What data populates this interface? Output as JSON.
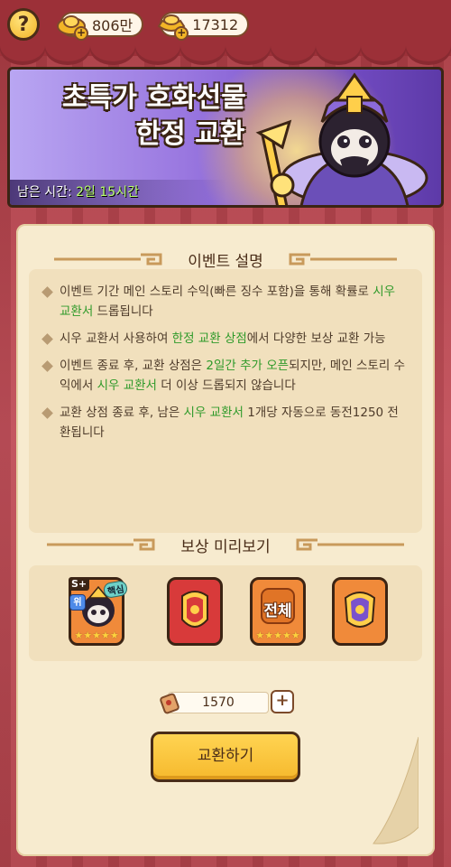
{
  "topbar": {
    "help_label": "?",
    "currencies": [
      {
        "icon": "gold-ingot-icon",
        "value": "806만"
      },
      {
        "icon": "silver-ingot-icon",
        "value": "17312"
      }
    ]
  },
  "banner": {
    "title_line1": "초특가 호화선물",
    "title_line2": "한정 교환",
    "time_label": "남은 시간: ",
    "time_value": "2일 15시간"
  },
  "description": {
    "title": "이벤트 설명",
    "items": [
      {
        "parts": [
          "이벤트 기간 메인 스토리 수익(빠른 징수 포함)을 통해 확률로 ",
          "시우 교환서",
          " 드롭됩니다"
        ]
      },
      {
        "parts": [
          "시우 교환서 사용하여 ",
          "한정 교환 상점",
          "에서 다양한 보상 교환 가능"
        ]
      },
      {
        "parts": [
          "이벤트 종료 후, 교환 상점은 ",
          "2일간 추가 오픈",
          "되지만, 메인 스토리 수익에서 ",
          "시우 교환서",
          " 더 이상 드롭되지 않습니다"
        ]
      },
      {
        "parts": [
          "교환 상점 종료 후, 남은 ",
          "시우 교환서",
          " 1개당 자동으로 동전1250 전환됩니다"
        ]
      }
    ]
  },
  "rewards": {
    "title": "보상 미리보기",
    "items": [
      {
        "kind": "hero-card",
        "rarity_badge": "S+",
        "position_badge": "위",
        "tag": "핵심",
        "stars": 5
      },
      {
        "kind": "red-emblem",
        "stars": 0
      },
      {
        "kind": "orange-all",
        "label": "전체",
        "stars": 5
      },
      {
        "kind": "purple-emblem",
        "stars": 0
      }
    ]
  },
  "exchange": {
    "quantity": "1570",
    "plus_label": "+",
    "button_label": "교환하기"
  },
  "colors": {
    "accent_green": "#2f9a2a",
    "button_yellow": "#f6b92d",
    "panel_bg": "#f7ebcf"
  }
}
